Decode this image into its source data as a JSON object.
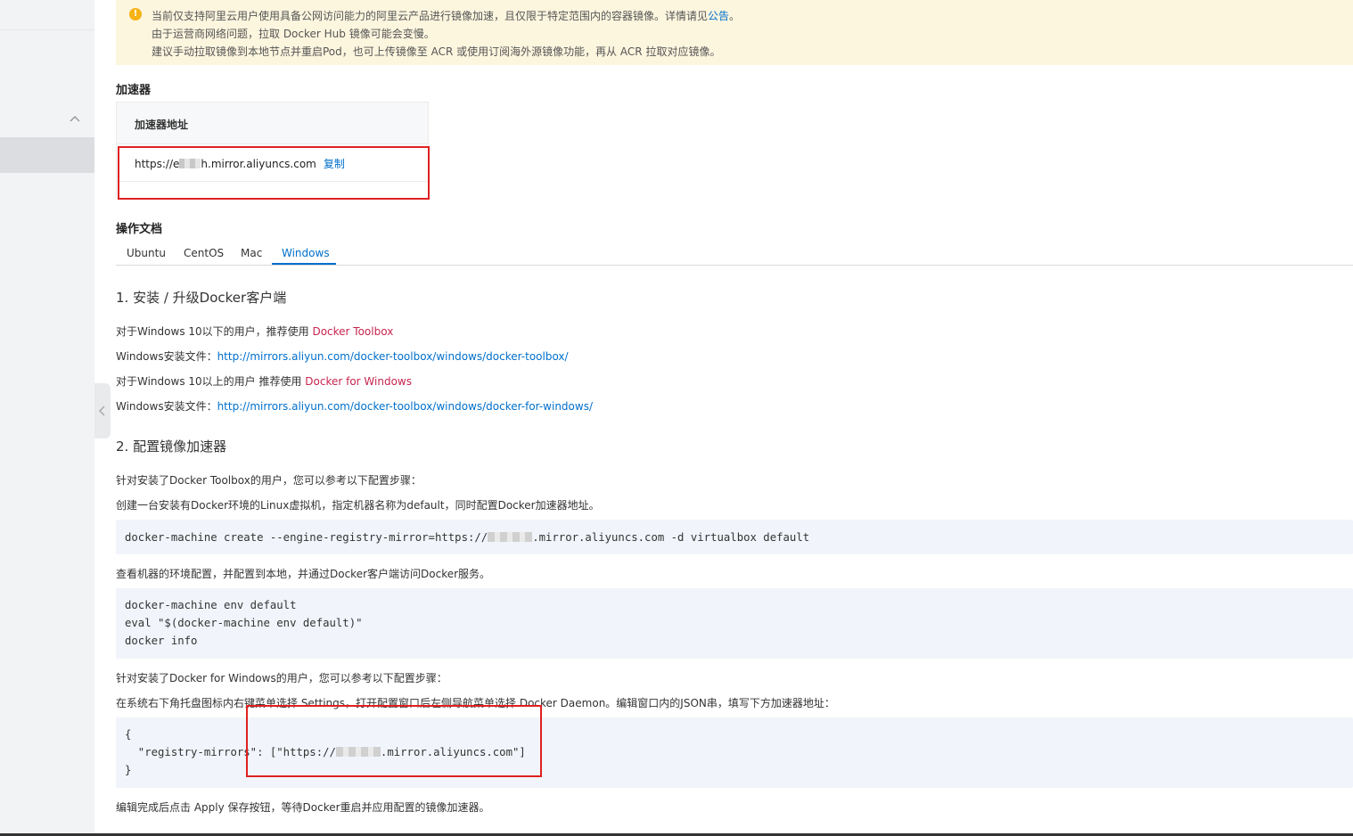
{
  "notice": {
    "line1_pre": "当前仅支持阿里云用户使用具备公网访问能力的阿里云产品进行镜像加速，且仅限于特定范围内的容器镜像。详情请见",
    "line1_link": "公告",
    "line1_post": "。",
    "line2": "由于运营商网络问题，拉取 Docker Hub 镜像可能会变慢。",
    "line3": "建议手动拉取镜像到本地节点并重启Pod，也可上传镜像至 ACR 或使用订阅海外源镜像功能，再从 ACR 拉取对应镜像。",
    "icon": "warning-icon"
  },
  "accelerator": {
    "section_title": "加速器",
    "column_header": "加速器地址",
    "url_prefix": "https://e",
    "url_suffix": "h.mirror.aliyuncs.com",
    "copy_label": "复制"
  },
  "docs": {
    "section_title": "操作文档",
    "tabs": [
      {
        "label": "Ubuntu"
      },
      {
        "label": "CentOS"
      },
      {
        "label": "Mac"
      },
      {
        "label": "Windows"
      }
    ],
    "active_tab": "Windows",
    "step1": {
      "heading": "1. 安装 / 升级Docker客户端",
      "p1_text": "对于Windows 10以下的用户，推荐使用 ",
      "p1_highlight": "Docker Toolbox",
      "p2_text": "Windows安装文件：",
      "p2_link": "http://mirrors.aliyun.com/docker-toolbox/windows/docker-toolbox/",
      "p3_text": "对于Windows 10以上的用户 推荐使用 ",
      "p3_highlight": "Docker for Windows",
      "p4_text": "Windows安装文件：",
      "p4_link": "http://mirrors.aliyun.com/docker-toolbox/windows/docker-for-windows/"
    },
    "step2": {
      "heading": "2. 配置镜像加速器",
      "p1": "针对安装了Docker Toolbox的用户，您可以参考以下配置步骤：",
      "p2": "创建一台安装有Docker环境的Linux虚拟机，指定机器名称为default，同时配置Docker加速器地址。",
      "code1_pre": "docker-machine create --engine-registry-mirror=https://",
      "code1_post": ".mirror.aliyuncs.com -d virtualbox default",
      "p3": "查看机器的环境配置，并配置到本地，并通过Docker客户端访问Docker服务。",
      "code2_l1": "docker-machine env default",
      "code2_l2": "eval \"$(docker-machine env default)\"",
      "code2_l3": "docker info",
      "p4": "针对安装了Docker for Windows的用户，您可以参考以下配置步骤：",
      "p5": "在系统右下角托盘图标内右键菜单选择 Settings，打开配置窗口后左侧导航菜单选择 Docker Daemon。编辑窗口内的JSON串，填写下方加速器地址：",
      "code3_l1": "{",
      "code3_l2_pre": "  \"registry-mirrors\": [\"https://",
      "code3_l2_post": ".mirror.aliyuncs.com\"]",
      "code3_l3": "}",
      "p6": "编辑完成后点击 Apply 保存按钮，等待Docker重启并应用配置的镜像加速器。"
    }
  },
  "colors": {
    "link": "#0070cc",
    "highlight": "#c7254e",
    "annotation": "#e02020",
    "notice_bg": "#fdf6df",
    "code_bg": "#f1f5fb"
  }
}
